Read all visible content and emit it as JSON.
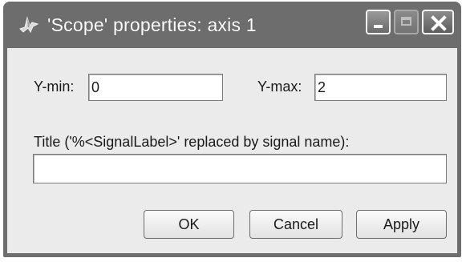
{
  "window": {
    "title": "'Scope' properties: axis 1",
    "icon": "simulink-icon",
    "controls": {
      "minimize": "minimize-icon",
      "maximize": "maximize-icon",
      "close": "close-icon"
    }
  },
  "form": {
    "ymin_label": "Y-min:",
    "ymin_value": "0",
    "ymax_label": "Y-max:",
    "ymax_value": "2",
    "title_label": "Title ('%<SignalLabel>' replaced by signal name):",
    "title_value": ""
  },
  "buttons": {
    "ok": "OK",
    "cancel": "Cancel",
    "apply": "Apply"
  }
}
